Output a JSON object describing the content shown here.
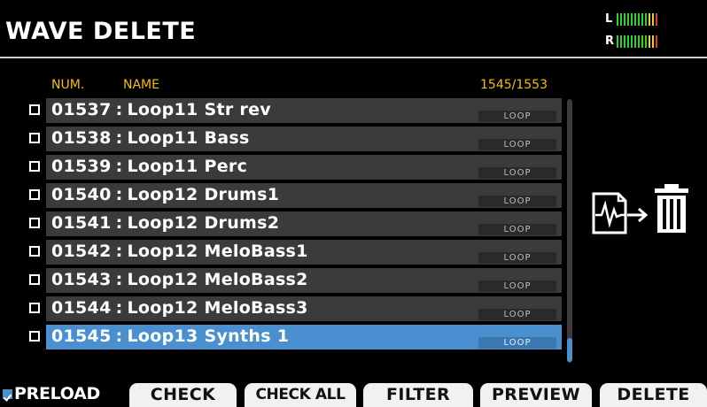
{
  "header": {
    "title": "WAVE DELETE",
    "meter": {
      "left_label": "L",
      "right_label": "R",
      "segment_colors": [
        "#2fd12f",
        "#2fd12f",
        "#2fd12f",
        "#2fd12f",
        "#2fd12f",
        "#2fd12f",
        "#2fd12f",
        "#2fd12f",
        "#2fd12f",
        "#e8d21a",
        "#e8d21a",
        "#e03a2a"
      ]
    }
  },
  "list": {
    "col_num": "NUM.",
    "col_name": "NAME",
    "counter": "1545/1553",
    "rows": [
      {
        "num": "01537",
        "name": "Loop11 Str rev",
        "tag": "LOOP",
        "checked": false,
        "selected": false
      },
      {
        "num": "01538",
        "name": "Loop11 Bass",
        "tag": "LOOP",
        "checked": false,
        "selected": false
      },
      {
        "num": "01539",
        "name": "Loop11 Perc",
        "tag": "LOOP",
        "checked": false,
        "selected": false
      },
      {
        "num": "01540",
        "name": "Loop12 Drums1",
        "tag": "LOOP",
        "checked": false,
        "selected": false
      },
      {
        "num": "01541",
        "name": "Loop12 Drums2",
        "tag": "LOOP",
        "checked": false,
        "selected": false
      },
      {
        "num": "01542",
        "name": "Loop12 MeloBass1",
        "tag": "LOOP",
        "checked": false,
        "selected": false
      },
      {
        "num": "01543",
        "name": "Loop12 MeloBass2",
        "tag": "LOOP",
        "checked": false,
        "selected": false
      },
      {
        "num": "01544",
        "name": "Loop12 MeloBass3",
        "tag": "LOOP",
        "checked": false,
        "selected": false
      },
      {
        "num": "01545",
        "name": "Loop13 Synths 1",
        "tag": "LOOP",
        "checked": false,
        "selected": true
      }
    ],
    "separator": ":"
  },
  "icons": {
    "action": "wave-to-trash-icon"
  },
  "footer": {
    "preload_label": "PRELOAD",
    "preload_checked": true,
    "buttons": {
      "check": "CHECK",
      "check_all": "CHECK ALL",
      "filter": "FILTER",
      "preview": "PREVIEW",
      "delete": "DELETE"
    }
  },
  "colors": {
    "background": "#000000",
    "header_label": "#f0c000",
    "row": "#3b3b3b",
    "selected_row": "#4a8fd0",
    "button": "#f1f1f1"
  }
}
